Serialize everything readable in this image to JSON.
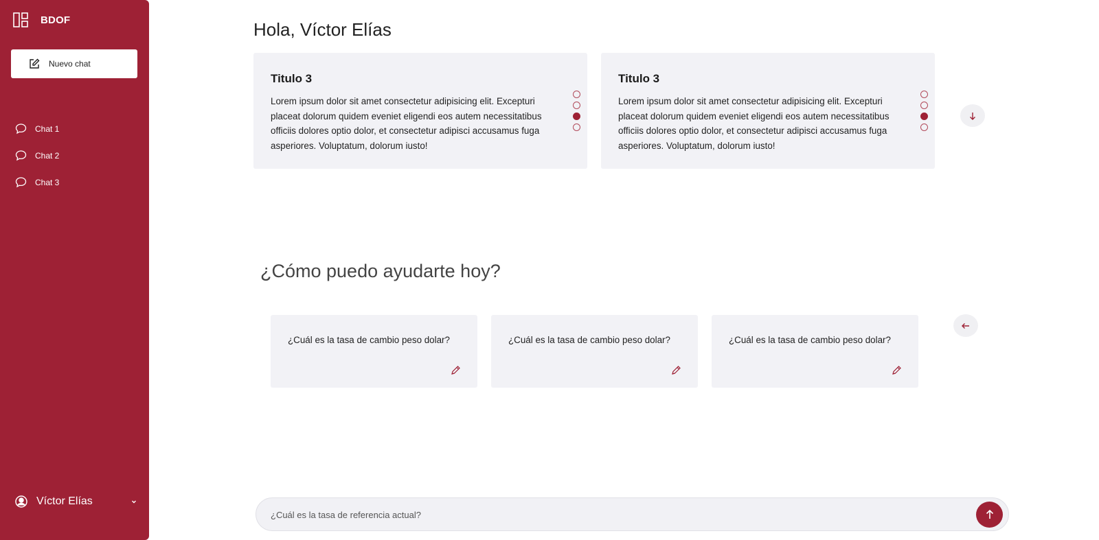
{
  "sidebar": {
    "brand": "BDOF",
    "new_chat_label": "Nuevo chat",
    "chats": [
      {
        "label": "Chat 1"
      },
      {
        "label": "Chat 2"
      },
      {
        "label": "Chat 3"
      }
    ],
    "user_name": "Víctor Elías"
  },
  "main": {
    "greeting": "Hola, Víctor Elías",
    "info_cards": [
      {
        "title": "Titulo 3",
        "body": "Lorem ipsum dolor sit amet consectetur adipisicing elit. Excepturi placeat dolorum quidem eveniet eligendi eos autem necessitatibus officiis dolores optio dolor, et consectetur adipisci accusamus fuga asperiores. Voluptatum, dolorum iusto!",
        "pages": 4,
        "active_page": 3
      },
      {
        "title": "Titulo 3",
        "body": "Lorem ipsum dolor sit amet consectetur adipisicing elit. Excepturi placeat dolorum quidem eveniet eligendi eos autem necessitatibus officiis dolores optio dolor, et consectetur adipisci accusamus fuga asperiores. Voluptatum, dolorum iusto!",
        "pages": 4,
        "active_page": 3
      }
    ],
    "help_title": "¿Cómo puedo ayudarte hoy?",
    "suggestions": [
      {
        "text": "¿Cuál es la tasa de cambio peso dolar?"
      },
      {
        "text": "¿Cuál es la tasa de cambio peso dolar?"
      },
      {
        "text": "¿Cuál es la tasa de cambio peso dolar?"
      }
    ]
  },
  "composer": {
    "placeholder": "¿Cuál es la tasa de referencia actual?"
  },
  "icons": {
    "brand": "dashboard-icon",
    "new_chat": "edit-icon",
    "chat": "speech-bubble-icon",
    "user": "user-circle-icon",
    "user_menu": "chevron-down-icon",
    "scroll": "arrow-down-icon",
    "back": "arrow-left-icon",
    "suggestion": "pencil-icon",
    "send": "arrow-up-icon"
  },
  "colors": {
    "brand": "#9e2135",
    "card_bg": "#f2f2f6",
    "text": "#1f1f1f"
  }
}
